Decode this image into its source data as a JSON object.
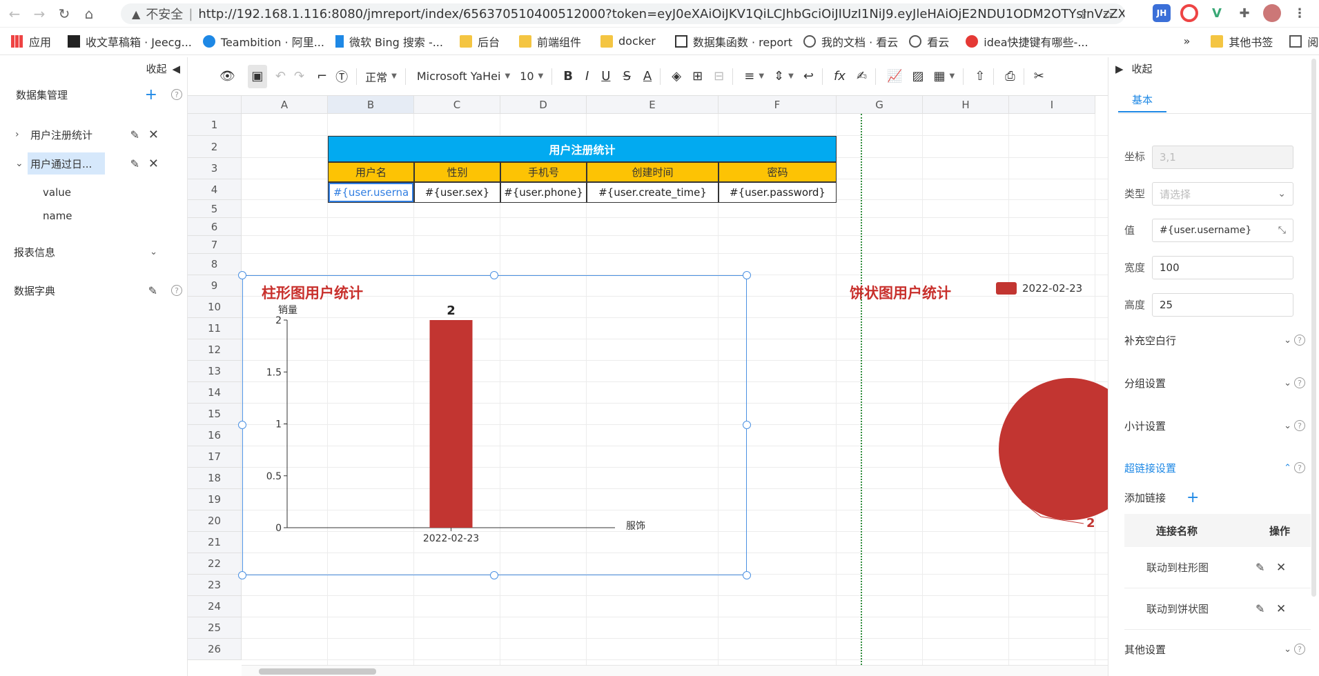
{
  "browser": {
    "insecure": "不安全",
    "url": "http://192.168.1.116:8080/jmreport/index/656370510400512000?token=eyJ0eXAiOiJKV1QiLCJhbGciOiJIUzI1NiJ9.eyJleHAiOjE2NDU1ODM2OTYsInVzZXJ..."
  },
  "bookmarks": [
    {
      "label": "应用"
    },
    {
      "label": "收文草稿箱 · Jeecg..."
    },
    {
      "label": "Teambition · 阿里..."
    },
    {
      "label": "微软 Bing 搜索 -..."
    },
    {
      "label": "后台"
    },
    {
      "label": "前端组件"
    },
    {
      "label": "docker"
    },
    {
      "label": "数据集函数 · report"
    },
    {
      "label": "我的文档 · 看云"
    },
    {
      "label": "看云"
    },
    {
      "label": "idea快捷键有哪些-..."
    },
    {
      "label": "»"
    },
    {
      "label": "其他书签"
    },
    {
      "label": "阅读清单"
    }
  ],
  "left_panel": {
    "collapse_label": "收起",
    "dataset_title": "数据集管理",
    "datasets": [
      {
        "label": "用户注册统计"
      },
      {
        "label": "用户通过日..."
      }
    ],
    "fields": [
      "value",
      "name"
    ],
    "report_info": "报表信息",
    "dictionary": "数据字典"
  },
  "toolbar": {
    "format": "正常",
    "font": "Microsoft YaHei",
    "size": "10"
  },
  "sheet": {
    "columns": [
      "A",
      "B",
      "C",
      "D",
      "E",
      "F",
      "G",
      "H",
      "I"
    ],
    "rows": [
      "1",
      "2",
      "3",
      "4",
      "5",
      "6",
      "7",
      "8",
      "9",
      "10",
      "11",
      "12",
      "13",
      "14",
      "15",
      "16",
      "17",
      "18",
      "19",
      "20",
      "21",
      "22",
      "23",
      "24",
      "25",
      "26"
    ],
    "table_title": "用户注册统计",
    "headers": [
      "用户名",
      "性别",
      "手机号",
      "创建时间",
      "密码"
    ],
    "cells": [
      "#{user.userna",
      "#{user.sex}",
      "#{user.phone}",
      "#{user.create_time}",
      "#{user.password}"
    ]
  },
  "bar_chart_title": "柱形图用户统计",
  "pie_chart_title": "饼状图用户统计",
  "chart_data": [
    {
      "type": "bar",
      "title": "",
      "ylabel": "销量",
      "xlabel": "服饰",
      "categories": [
        "2022-02-23"
      ],
      "values": [
        2
      ],
      "ylim": [
        0,
        2
      ],
      "yticks": [
        "0",
        "0.5",
        "1",
        "1.5",
        "2"
      ],
      "data_label": "2",
      "color": "#c23531"
    },
    {
      "type": "pie",
      "title": "",
      "legend": [
        "2022-02-23"
      ],
      "values": [
        2
      ],
      "data_label": "2",
      "color": "#c23531"
    }
  ],
  "right_panel": {
    "collapse_label": "收起",
    "tab": "基本",
    "coord_label": "坐标",
    "coord_value": "3,1",
    "type_label": "类型",
    "type_placeholder": "请选择",
    "value_label": "值",
    "value_value": "#{user.username}",
    "width_label": "宽度",
    "width_value": "100",
    "height_label": "高度",
    "height_value": "25",
    "sections": [
      "补充空白行",
      "分组设置",
      "小计设置",
      "超链接设置"
    ],
    "add_link": "添加链接",
    "link_header_name": "连接名称",
    "link_header_op": "操作",
    "links": [
      "联动到柱形图",
      "联动到饼状图"
    ],
    "other_settings": "其他设置"
  }
}
